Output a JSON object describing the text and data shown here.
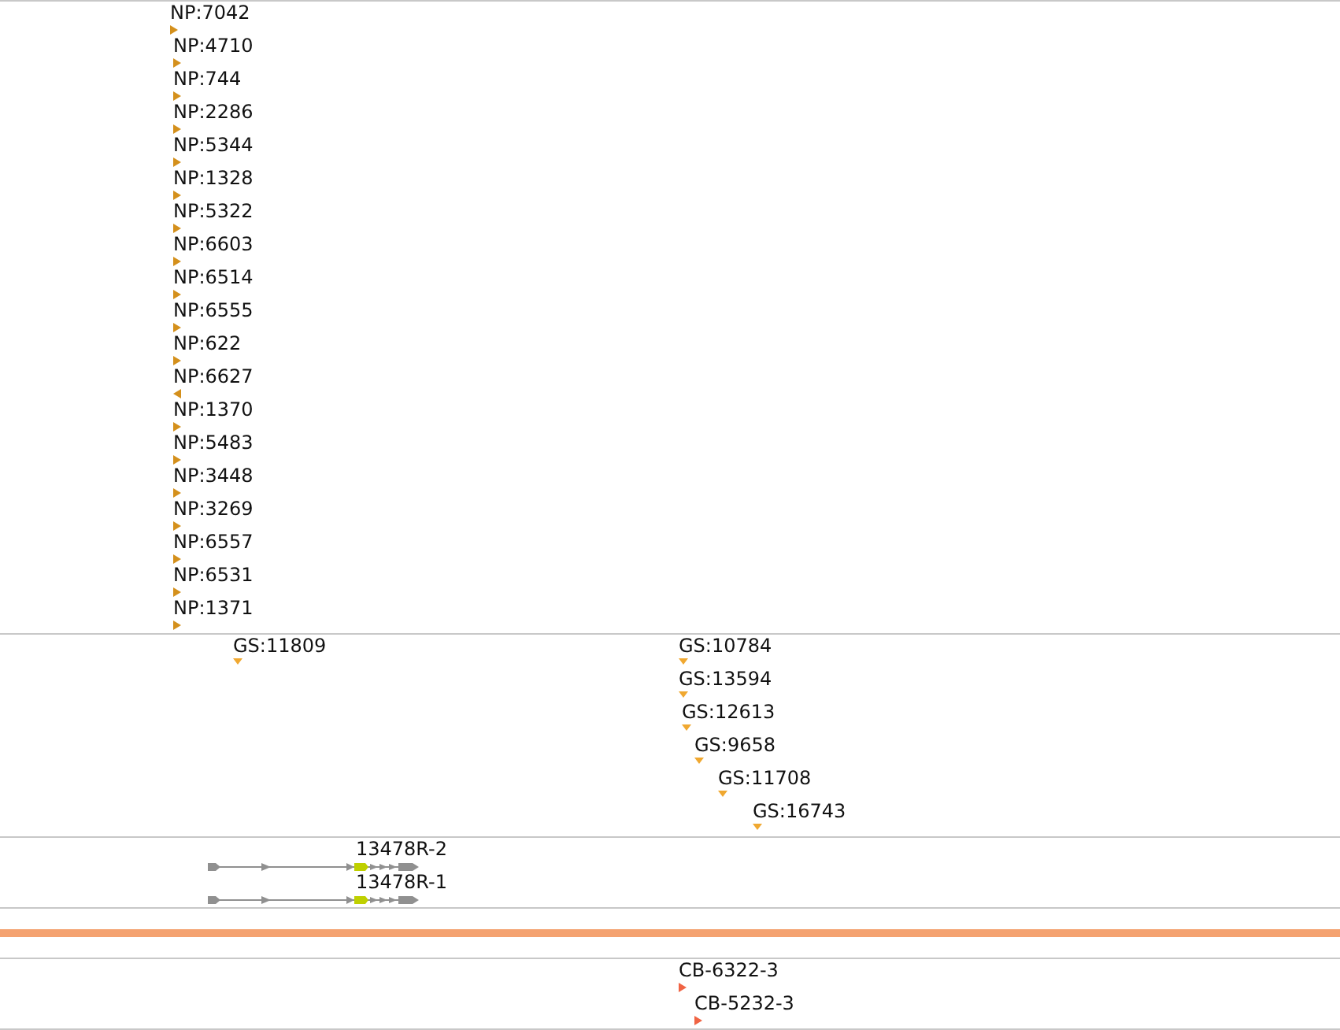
{
  "tracks": [
    {
      "kind": "stranded",
      "color": "#d4901c",
      "features": [
        {
          "label": "NP:7042",
          "reverse": false
        },
        {
          "label": "NP:4710",
          "reverse": false
        },
        {
          "label": "NP:744",
          "reverse": false
        },
        {
          "label": "NP:2286",
          "reverse": false
        },
        {
          "label": "NP:5344",
          "reverse": false
        },
        {
          "label": "NP:1328",
          "reverse": false
        },
        {
          "label": "NP:5322",
          "reverse": false
        },
        {
          "label": "NP:6603",
          "reverse": false
        },
        {
          "label": "NP:6514",
          "reverse": false
        },
        {
          "label": "NP:6555",
          "reverse": false
        },
        {
          "label": "NP:622",
          "reverse": false
        },
        {
          "label": "NP:6627",
          "reverse": true
        },
        {
          "label": "NP:1370",
          "reverse": false
        },
        {
          "label": "NP:5483",
          "reverse": false
        },
        {
          "label": "NP:3448",
          "reverse": false
        },
        {
          "label": "NP:3269",
          "reverse": false
        },
        {
          "label": "NP:6557",
          "reverse": false
        },
        {
          "label": "NP:6531",
          "reverse": false
        },
        {
          "label": "NP:1371",
          "reverse": false
        }
      ]
    },
    {
      "kind": "unstranded",
      "color": "#f0a830",
      "features": [
        {
          "label": "GS:11809"
        },
        {
          "label": "GS:10784"
        },
        {
          "label": "GS:13594"
        },
        {
          "label": "GS:12613"
        },
        {
          "label": "GS:9658"
        },
        {
          "label": "GS:11708"
        },
        {
          "label": "GS:16743"
        }
      ]
    },
    {
      "kind": "transcripts",
      "transcripts": [
        {
          "label": "13478R-2"
        },
        {
          "label": "13478R-1"
        }
      ]
    },
    {
      "kind": "highlight"
    },
    {
      "kind": "stranded",
      "color": "#f06444",
      "features": [
        {
          "label": "CB-6322-3",
          "reverse": false
        },
        {
          "label": "CB-5232-3",
          "reverse": false
        }
      ]
    }
  ]
}
